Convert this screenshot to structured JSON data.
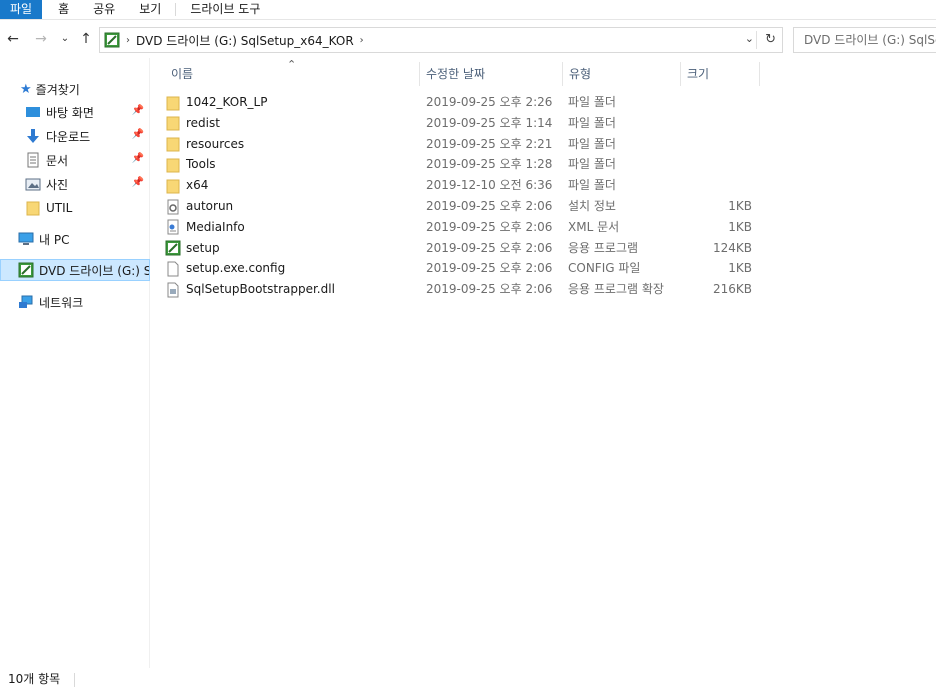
{
  "ribbon": {
    "tabs": [
      "파일",
      "홈",
      "공유",
      "보기",
      "드라이브 도구"
    ]
  },
  "address": {
    "crumbs": [
      "DVD 드라이브 (G:) SqlSetup_x64_KOR"
    ],
    "search_placeholder": "DVD 드라이브 (G:) SqlSet"
  },
  "nav": {
    "quick_access": "즐겨찾기",
    "items": [
      {
        "label": "바탕 화면",
        "pinned": true,
        "icon": "desktop-icon"
      },
      {
        "label": "다운로드",
        "pinned": true,
        "icon": "download-icon"
      },
      {
        "label": "문서",
        "pinned": true,
        "icon": "document-icon"
      },
      {
        "label": "사진",
        "pinned": true,
        "icon": "pictures-icon"
      },
      {
        "label": "UTIL",
        "pinned": false,
        "icon": "folder-icon"
      }
    ],
    "this_pc": "내 PC",
    "dvd_drive": "DVD 드라이브 (G:) S",
    "network": "네트워크",
    "pin_glyph": "📌"
  },
  "columns": {
    "name": "이름",
    "date": "수정한 날짜",
    "type": "유형",
    "size": "크기"
  },
  "files": [
    {
      "name": "1042_KOR_LP",
      "date": "2019-09-25 오후 2:26",
      "type": "파일 폴더",
      "size": "",
      "icon": "folder"
    },
    {
      "name": "redist",
      "date": "2019-09-25 오후 1:14",
      "type": "파일 폴더",
      "size": "",
      "icon": "folder"
    },
    {
      "name": "resources",
      "date": "2019-09-25 오후 2:21",
      "type": "파일 폴더",
      "size": "",
      "icon": "folder"
    },
    {
      "name": "Tools",
      "date": "2019-09-25 오후 1:28",
      "type": "파일 폴더",
      "size": "",
      "icon": "folder"
    },
    {
      "name": "x64",
      "date": "2019-12-10 오전 6:36",
      "type": "파일 폴더",
      "size": "",
      "icon": "folder"
    },
    {
      "name": "autorun",
      "date": "2019-09-25 오후 2:06",
      "type": "설치 정보",
      "size": "1KB",
      "icon": "settings-file"
    },
    {
      "name": "MediaInfo",
      "date": "2019-09-25 오후 2:06",
      "type": "XML 문서",
      "size": "1KB",
      "icon": "xml-file"
    },
    {
      "name": "setup",
      "date": "2019-09-25 오후 2:06",
      "type": "응용 프로그램",
      "size": "124KB",
      "icon": "setup-app"
    },
    {
      "name": "setup.exe.config",
      "date": "2019-09-25 오후 2:06",
      "type": "CONFIG 파일",
      "size": "1KB",
      "icon": "blank-file"
    },
    {
      "name": "SqlSetupBootstrapper.dll",
      "date": "2019-09-25 오후 2:06",
      "type": "응용 프로그램 확장",
      "size": "216KB",
      "icon": "dll-file"
    }
  ],
  "status": {
    "item_count": "10개 항목"
  }
}
